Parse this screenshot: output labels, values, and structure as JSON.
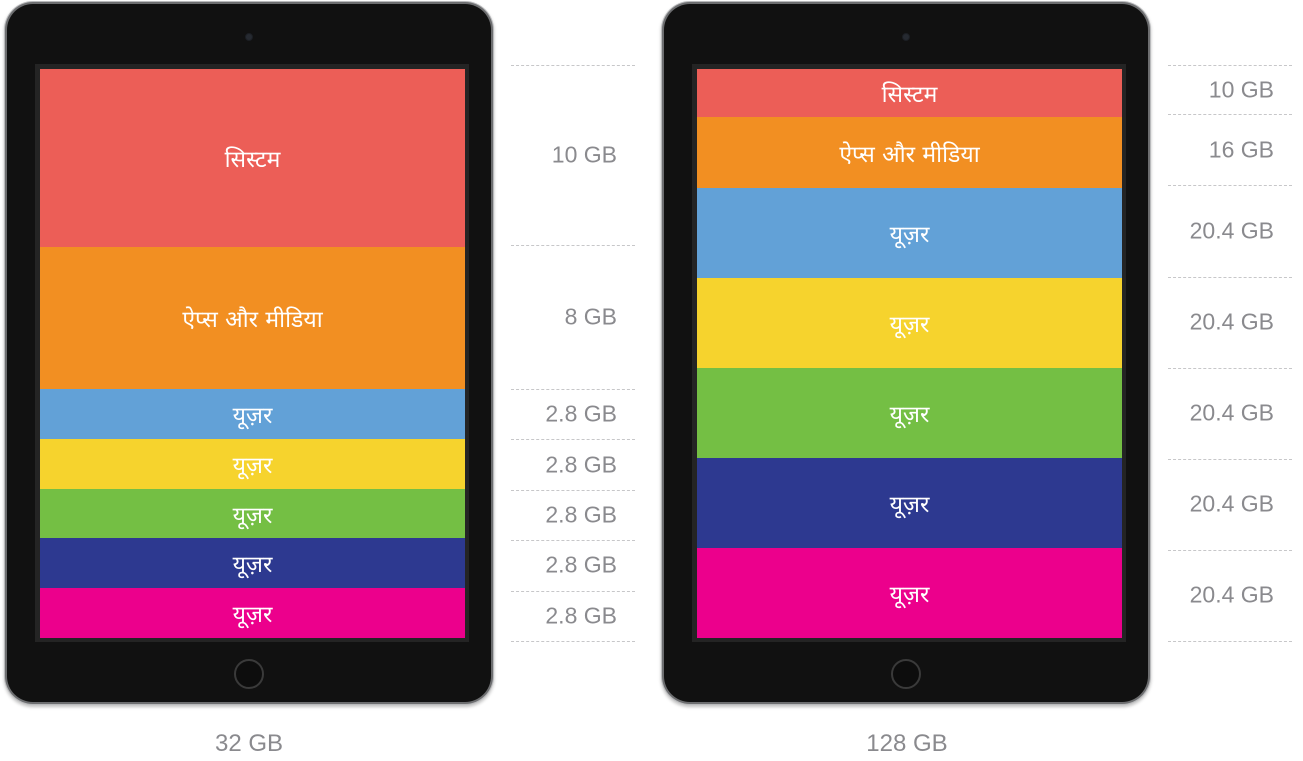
{
  "devices": [
    {
      "capacity": "32 GB",
      "segments": [
        {
          "label": "सिस्टम",
          "size": "10 GB",
          "gb": 10,
          "color": "#ec5e57"
        },
        {
          "label": "ऐप्स और मीडिया",
          "size": "8 GB",
          "gb": 8,
          "color": "#f28f22"
        },
        {
          "label": "यूज़र",
          "size": "2.8 GB",
          "gb": 2.8,
          "color": "#62a1d7"
        },
        {
          "label": "यूज़र",
          "size": "2.8 GB",
          "gb": 2.8,
          "color": "#f6d32d"
        },
        {
          "label": "यूज़र",
          "size": "2.8 GB",
          "gb": 2.8,
          "color": "#74bf44"
        },
        {
          "label": "यूज़र",
          "size": "2.8 GB",
          "gb": 2.8,
          "color": "#2d3990"
        },
        {
          "label": "यूज़र",
          "size": "2.8 GB",
          "gb": 2.8,
          "color": "#ec008c"
        }
      ]
    },
    {
      "capacity": "128 GB",
      "segments": [
        {
          "label": "सिस्टम",
          "size": "10 GB",
          "gb": 10,
          "color": "#ec5e57"
        },
        {
          "label": "ऐप्स और मीडिया",
          "size": "16 GB",
          "gb": 16,
          "color": "#f28f22"
        },
        {
          "label": "यूज़र",
          "size": "20.4 GB",
          "gb": 20.4,
          "color": "#62a1d7"
        },
        {
          "label": "यूज़र",
          "size": "20.4 GB",
          "gb": 20.4,
          "color": "#f6d32d"
        },
        {
          "label": "यूज़र",
          "size": "20.4 GB",
          "gb": 20.4,
          "color": "#74bf44"
        },
        {
          "label": "यूज़र",
          "size": "20.4 GB",
          "gb": 20.4,
          "color": "#2d3990"
        },
        {
          "label": "यूज़र",
          "size": "20.4 GB",
          "gb": 20.4,
          "color": "#ec008c"
        }
      ]
    }
  ]
}
